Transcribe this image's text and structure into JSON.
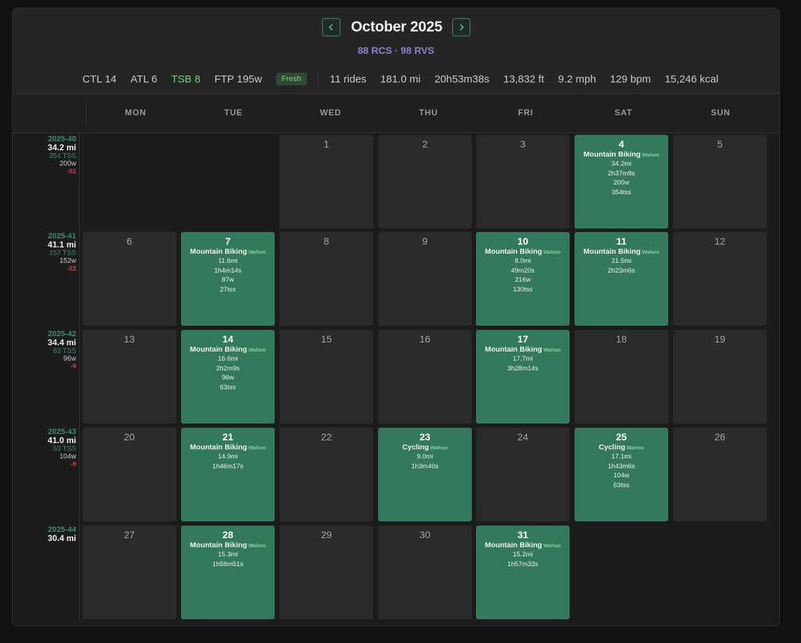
{
  "header": {
    "title": "October 2025",
    "subtitle": "88 RCS · 98 RVS",
    "prev_icon": "chevron-left-icon",
    "next_icon": "chevron-right-icon",
    "accent_color": "#3c8a66"
  },
  "stats": {
    "ctl": "CTL 14",
    "atl": "ATL 6",
    "tsb": "TSB 8",
    "ftp": "FTP 195w",
    "badge": "Fresh",
    "rides": "11 rides",
    "distance": "181.0 mi",
    "time": "20h53m38s",
    "elevation": "13,832 ft",
    "speed": "9.2 mph",
    "heart_rate": "129 bpm",
    "calories": "15,246 kcal"
  },
  "weekdays": [
    "MON",
    "TUE",
    "WED",
    "THU",
    "FRI",
    "SAT",
    "SUN"
  ],
  "weeks": [
    {
      "label": "2025-40",
      "distance": "34.2 mi",
      "tss": "354 TSS",
      "power": "200w",
      "delta": "-51"
    },
    {
      "label": "2025-41",
      "distance": "41.1 mi",
      "tss": "157 TSS",
      "power": "152w",
      "delta": "-22"
    },
    {
      "label": "2025-42",
      "distance": "34.4 mi",
      "tss": "63 TSS",
      "power": "96w",
      "delta": "-9"
    },
    {
      "label": "2025-43",
      "distance": "41.0 mi",
      "tss": "63 TSS",
      "power": "104w",
      "delta": "-9"
    },
    {
      "label": "2025-44",
      "distance": "30.4 mi",
      "tss": "",
      "power": "",
      "delta": ""
    }
  ],
  "activity_colors": {
    "active": "#337a5c",
    "empty": "#2b2b2b"
  },
  "days": [
    {
      "day": "1",
      "week": 0,
      "col": 2
    },
    {
      "day": "2",
      "week": 0,
      "col": 3
    },
    {
      "day": "3",
      "week": 0,
      "col": 4
    },
    {
      "day": "4",
      "week": 0,
      "col": 5,
      "activity": {
        "type": "Mountain Biking",
        "source": "Wahoo",
        "lines": [
          "34.2mi",
          "2h37m8s",
          "200w",
          "354tss"
        ]
      }
    },
    {
      "day": "5",
      "week": 0,
      "col": 6
    },
    {
      "day": "6",
      "week": 1,
      "col": 0
    },
    {
      "day": "7",
      "week": 1,
      "col": 1,
      "activity": {
        "type": "Mountain Biking",
        "source": "Wahoo",
        "lines": [
          "11.6mi",
          "1h4m14s",
          "87w",
          "27tss"
        ]
      }
    },
    {
      "day": "8",
      "week": 1,
      "col": 2
    },
    {
      "day": "9",
      "week": 1,
      "col": 3
    },
    {
      "day": "10",
      "week": 1,
      "col": 4,
      "activity": {
        "type": "Mountain Biking",
        "source": "Wahoo",
        "lines": [
          "8.0mi",
          "49m20s",
          "216w",
          "130tss"
        ]
      }
    },
    {
      "day": "11",
      "week": 1,
      "col": 5,
      "activity": {
        "type": "Mountain Biking",
        "source": "Wahoo",
        "lines": [
          "21.5mi",
          "2h23m6s"
        ]
      }
    },
    {
      "day": "12",
      "week": 1,
      "col": 6
    },
    {
      "day": "13",
      "week": 2,
      "col": 0
    },
    {
      "day": "14",
      "week": 2,
      "col": 1,
      "activity": {
        "type": "Mountain Biking",
        "source": "Wahoo",
        "lines": [
          "16.6mi",
          "2h2m9s",
          "96w",
          "63tss"
        ]
      }
    },
    {
      "day": "15",
      "week": 2,
      "col": 2
    },
    {
      "day": "16",
      "week": 2,
      "col": 3
    },
    {
      "day": "17",
      "week": 2,
      "col": 4,
      "activity": {
        "type": "Mountain Biking",
        "source": "Wahoo",
        "lines": [
          "17.7mi",
          "3h28m14s"
        ]
      }
    },
    {
      "day": "18",
      "week": 2,
      "col": 5
    },
    {
      "day": "19",
      "week": 2,
      "col": 6
    },
    {
      "day": "20",
      "week": 3,
      "col": 0
    },
    {
      "day": "21",
      "week": 3,
      "col": 1,
      "activity": {
        "type": "Mountain Biking",
        "source": "Wahoo",
        "lines": [
          "14.9mi",
          "1h46m17s"
        ]
      }
    },
    {
      "day": "22",
      "week": 3,
      "col": 2
    },
    {
      "day": "23",
      "week": 3,
      "col": 3,
      "activity": {
        "type": "Cycling",
        "source": "Wahoo",
        "lines": [
          "9.0mi",
          "1h3m40s"
        ]
      }
    },
    {
      "day": "24",
      "week": 3,
      "col": 4
    },
    {
      "day": "25",
      "week": 3,
      "col": 5,
      "activity": {
        "type": "Cycling",
        "source": "Wahoo",
        "lines": [
          "17.1mi",
          "1h43m6s",
          "104w",
          "63tss"
        ]
      }
    },
    {
      "day": "26",
      "week": 3,
      "col": 6
    },
    {
      "day": "27",
      "week": 4,
      "col": 0
    },
    {
      "day": "28",
      "week": 4,
      "col": 1,
      "activity": {
        "type": "Mountain Biking",
        "source": "Wahoo",
        "lines": [
          "15.3mi",
          "1h58m51s"
        ]
      }
    },
    {
      "day": "29",
      "week": 4,
      "col": 2
    },
    {
      "day": "30",
      "week": 4,
      "col": 3
    },
    {
      "day": "31",
      "week": 4,
      "col": 4,
      "activity": {
        "type": "Mountain Biking",
        "source": "Wahoo",
        "lines": [
          "15.2mi",
          "1h57m33s"
        ]
      }
    }
  ]
}
